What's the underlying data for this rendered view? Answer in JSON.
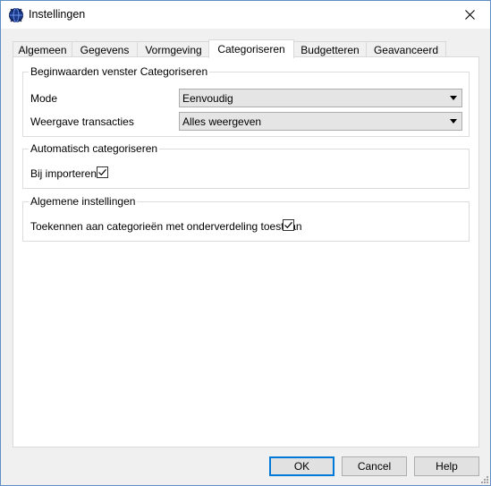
{
  "window": {
    "title": "Instellingen",
    "app_icon": "app-globe-icon",
    "close_icon": "close-icon"
  },
  "tabs": [
    {
      "label": "Algemeen"
    },
    {
      "label": "Gegevens"
    },
    {
      "label": "Vormgeving"
    },
    {
      "label": "Categoriseren",
      "active": true
    },
    {
      "label": "Budgetteren"
    },
    {
      "label": "Geavanceerd"
    }
  ],
  "groups": {
    "beginwaarden": {
      "title": "Beginwaarden venster Categoriseren",
      "mode_label": "Mode",
      "mode_value": "Eenvoudig",
      "weergave_label": "Weergave transacties",
      "weergave_value": "Alles weergeven"
    },
    "automatisch": {
      "title": "Automatisch categoriseren",
      "bij_importeren_label": "Bij importeren",
      "bij_importeren_checked": true
    },
    "algemeen": {
      "title": "Algemene instellingen",
      "toekennen_label": "Toekennen aan categorieën met onderverdeling toestaan",
      "toekennen_checked": true
    }
  },
  "buttons": {
    "ok": "OK",
    "cancel": "Cancel",
    "help": "Help"
  },
  "colors": {
    "default_button_border": "#0078d7",
    "window_border": "#5f8fc5"
  }
}
